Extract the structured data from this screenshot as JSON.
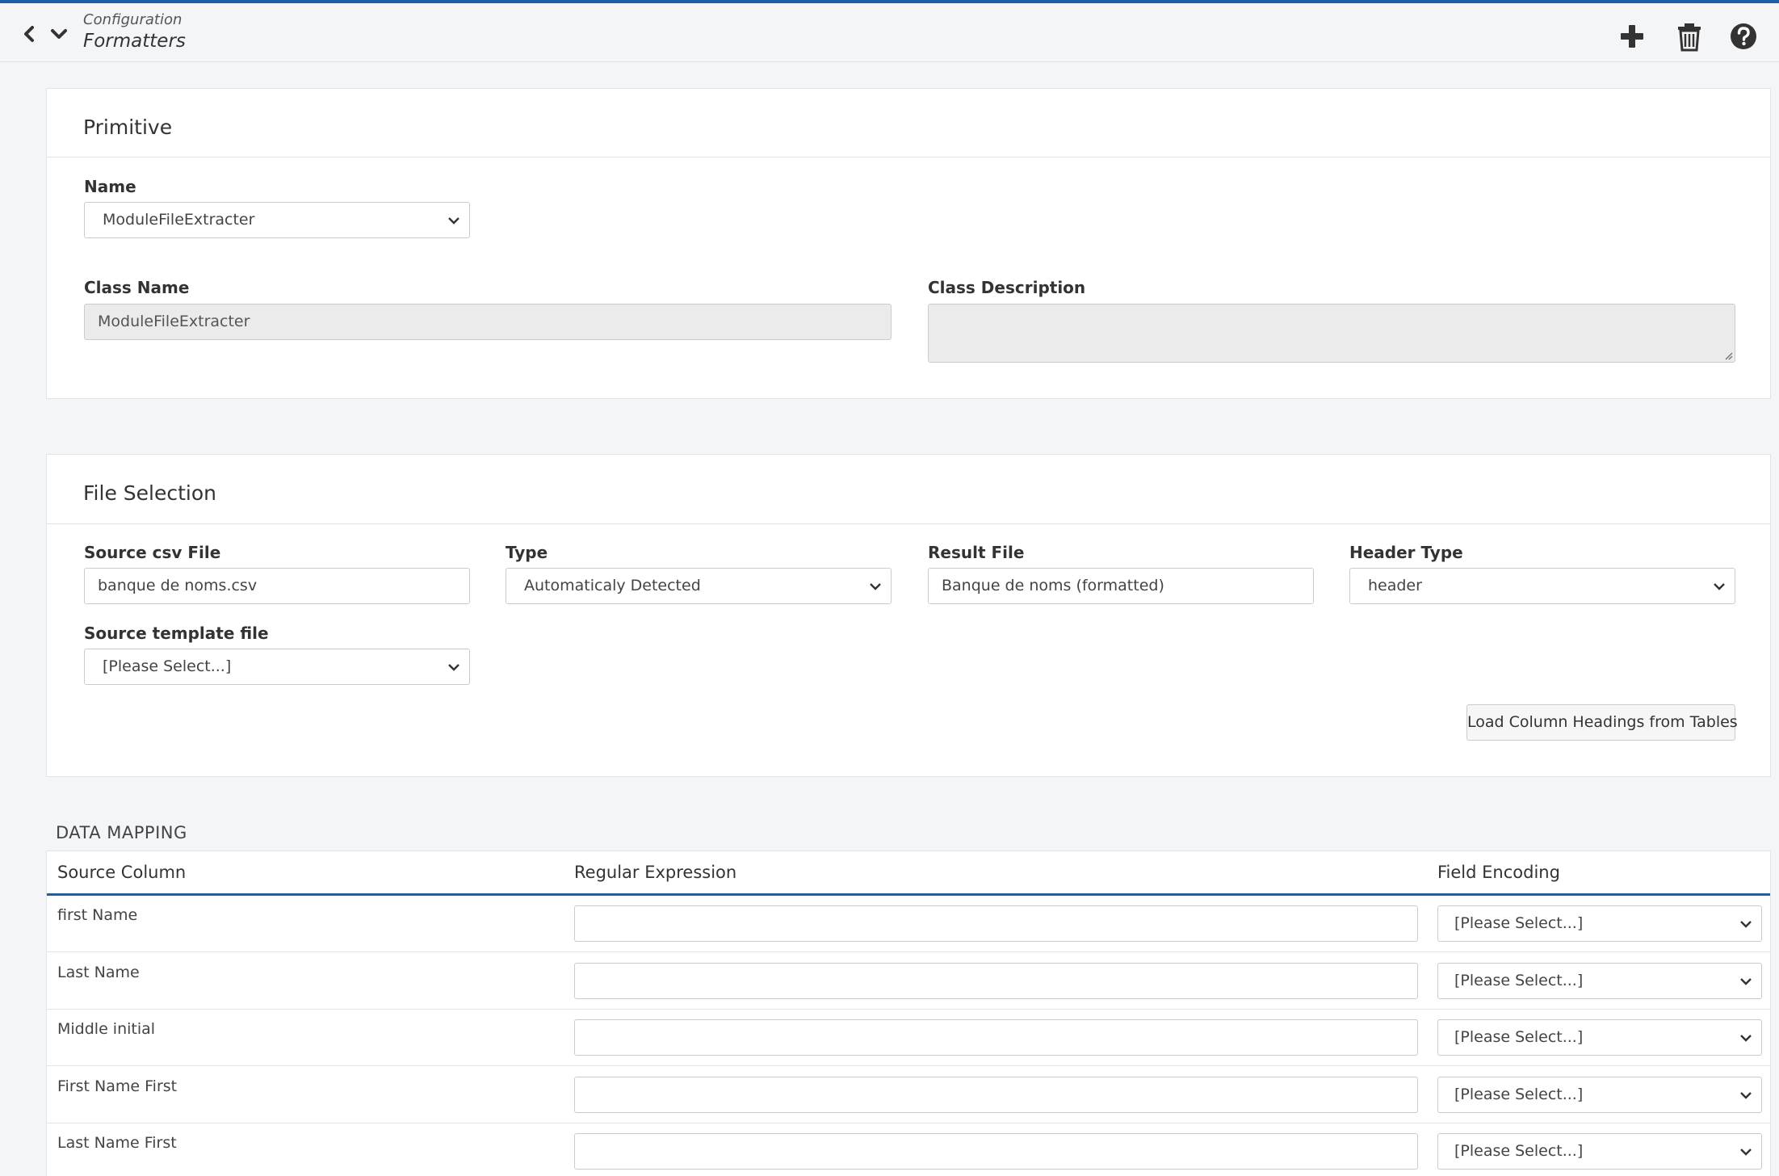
{
  "header": {
    "breadcrumb": "Configuration",
    "title": "Formatters"
  },
  "primitive": {
    "title": "Primitive",
    "name_label": "Name",
    "name_value": "ModuleFileExtracter",
    "class_name_label": "Class Name",
    "class_name_value": "ModuleFileExtracter",
    "class_description_label": "Class Description",
    "class_description_value": ""
  },
  "file_selection": {
    "title": "File Selection",
    "source_csv_label": "Source csv File",
    "source_csv_value": "banque de noms.csv",
    "type_label": "Type",
    "type_value": "Automaticaly Detected",
    "result_file_label": "Result File",
    "result_file_value": "Banque de noms (formatted)",
    "header_type_label": "Header Type",
    "header_type_value": "header",
    "template_label": "Source template file",
    "template_value": "[Please Select...]",
    "load_button": "Load Column Headings from Tables"
  },
  "data_mapping": {
    "title": "DATA MAPPING",
    "columns": [
      "Source Column",
      "Regular Expression",
      "Field Encoding"
    ],
    "rows": [
      {
        "source": "first Name",
        "regex": "",
        "encoding": "[Please Select...]"
      },
      {
        "source": "Last Name",
        "regex": "",
        "encoding": "[Please Select...]"
      },
      {
        "source": "Middle initial",
        "regex": "",
        "encoding": "[Please Select...]"
      },
      {
        "source": "First Name First",
        "regex": "",
        "encoding": "[Please Select...]"
      },
      {
        "source": "Last Name First",
        "regex": "",
        "encoding": "[Please Select...]"
      }
    ]
  },
  "colors": {
    "accent": "#1f5fa8",
    "background": "#f4f5f7",
    "readonly": "#ebebeb"
  }
}
